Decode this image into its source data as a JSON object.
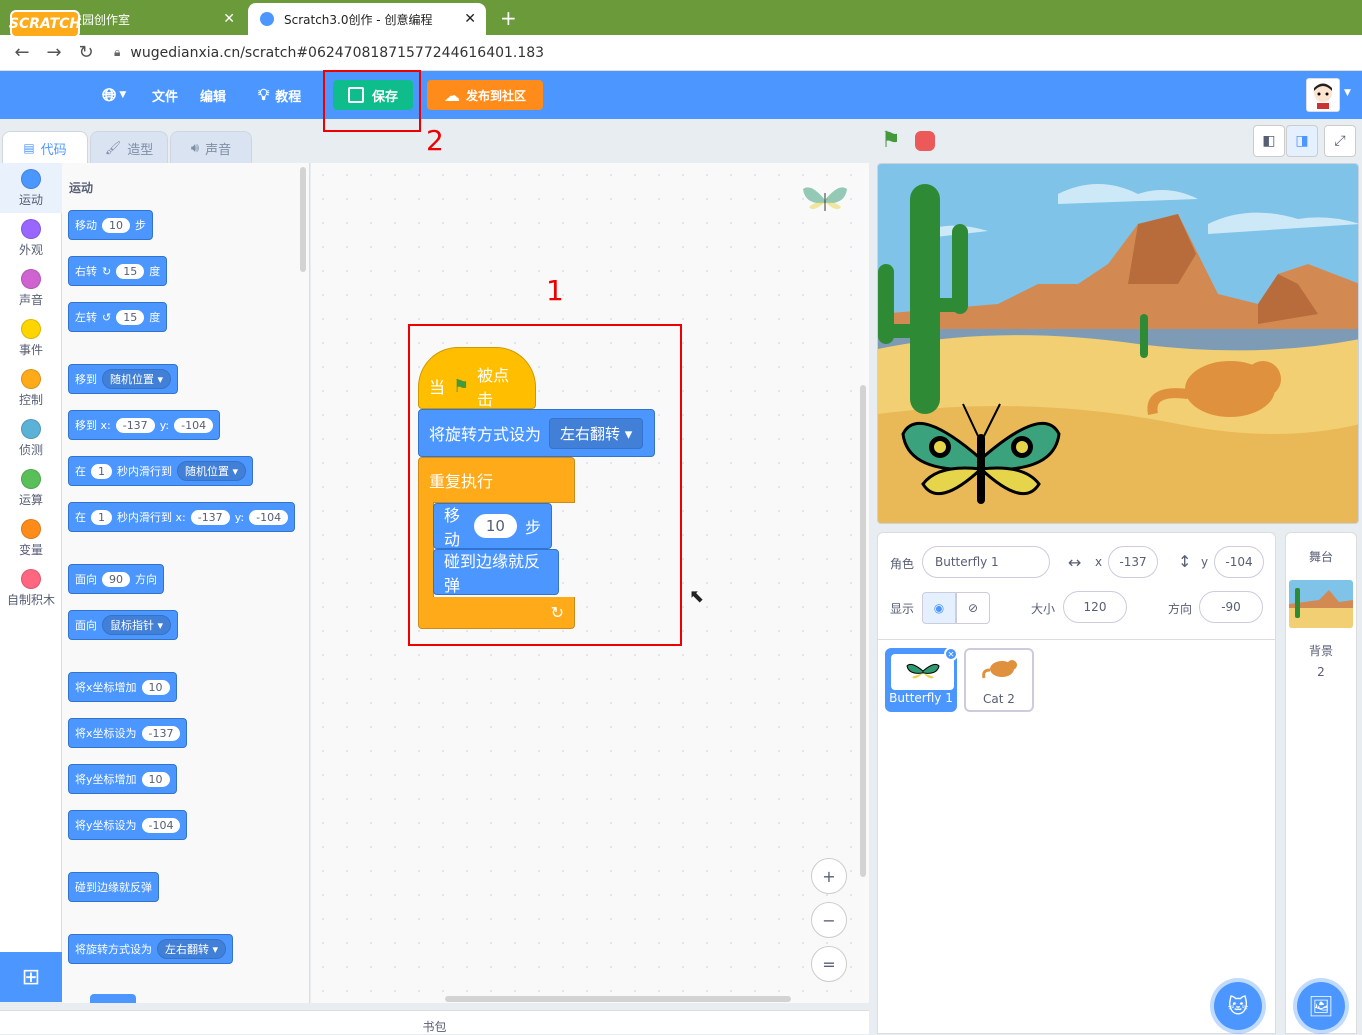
{
  "browser": {
    "tabs": [
      {
        "title": "学生校园创作室",
        "close": "✕"
      },
      {
        "title": "Scratch3.0创作 - 创意编程",
        "close": "✕"
      }
    ],
    "new_tab": "+",
    "url": "wugedianxia.cn/scratch#0624708187157724461​6401.183"
  },
  "menubar": {
    "logo": "SCRATCH",
    "file": "文件",
    "edit": "编辑",
    "tutorials": "教程",
    "save": "保存",
    "publish": "发布到社区"
  },
  "annotations": {
    "box1": "1",
    "box2": "2"
  },
  "editor_tabs": {
    "code": "代码",
    "costumes": "造型",
    "sounds": "声音"
  },
  "categories": [
    {
      "label": "运动",
      "color": "#4c97ff"
    },
    {
      "label": "外观",
      "color": "#9966ff"
    },
    {
      "label": "声音",
      "color": "#cf63cf"
    },
    {
      "label": "事件",
      "color": "#ffd500"
    },
    {
      "label": "控制",
      "color": "#ffab19"
    },
    {
      "label": "侦测",
      "color": "#5cb1d6"
    },
    {
      "label": "运算",
      "color": "#59c059"
    },
    {
      "label": "变量",
      "color": "#ff8c1a"
    },
    {
      "label": "自制积木",
      "color": "#ff6680"
    }
  ],
  "palette": {
    "title": "运动",
    "move": {
      "a": "移动",
      "v": "10",
      "b": "步"
    },
    "turn_right": {
      "a": "右转",
      "v": "15",
      "b": "度"
    },
    "turn_left": {
      "a": "左转",
      "v": "15",
      "b": "度"
    },
    "goto": {
      "a": "移到",
      "v": "随机位置"
    },
    "goto_xy": {
      "a": "移到 x:",
      "x": "-137",
      "yl": "y:",
      "y": "-104"
    },
    "glide": {
      "a": "在",
      "v": "1",
      "b": "秒内滑行到",
      "d": "随机位置"
    },
    "glide_xy": {
      "a": "在",
      "v": "1",
      "b": "秒内滑行到 x:",
      "x": "-137",
      "yl": "y:",
      "y": "-104"
    },
    "point": {
      "a": "面向",
      "v": "90",
      "b": "方向"
    },
    "point_towards": {
      "a": "面向",
      "v": "鼠标指针"
    },
    "change_x": {
      "a": "将x坐标增加",
      "v": "10"
    },
    "set_x": {
      "a": "将x坐标设为",
      "v": "-137"
    },
    "change_y": {
      "a": "将y坐标增加",
      "v": "10"
    },
    "set_y": {
      "a": "将y坐标设为",
      "v": "-104"
    },
    "bounce": {
      "a": "碰到边缘就反弹"
    },
    "rotation": {
      "a": "将旋转方式设为",
      "v": "左右翻转"
    }
  },
  "script": {
    "hat_a": "当",
    "hat_b": "被点击",
    "rotation_a": "将旋转方式设为",
    "rotation_v": "左右翻转",
    "forever": "重复执行",
    "move_a": "移动",
    "move_v": "10",
    "move_b": "步",
    "bounce": "碰到边缘就反弹"
  },
  "zoom": {
    "in": "+",
    "out": "−",
    "reset": "="
  },
  "backpack": "书包",
  "sprite_info": {
    "sprite_label": "角色",
    "sprite_name": "Butterfly 1",
    "x_label": "x",
    "x": "-137",
    "y_label": "y",
    "y": "-104",
    "show_label": "显示",
    "size_label": "大小",
    "size": "120",
    "direction_label": "方向",
    "direction": "-90"
  },
  "sprites": [
    {
      "name": "Butterfly 1",
      "selected": true
    },
    {
      "name": "Cat 2",
      "selected": false
    }
  ],
  "stage_pane": {
    "title": "舞台",
    "backdrop_label": "背景",
    "backdrop_count": "2"
  }
}
